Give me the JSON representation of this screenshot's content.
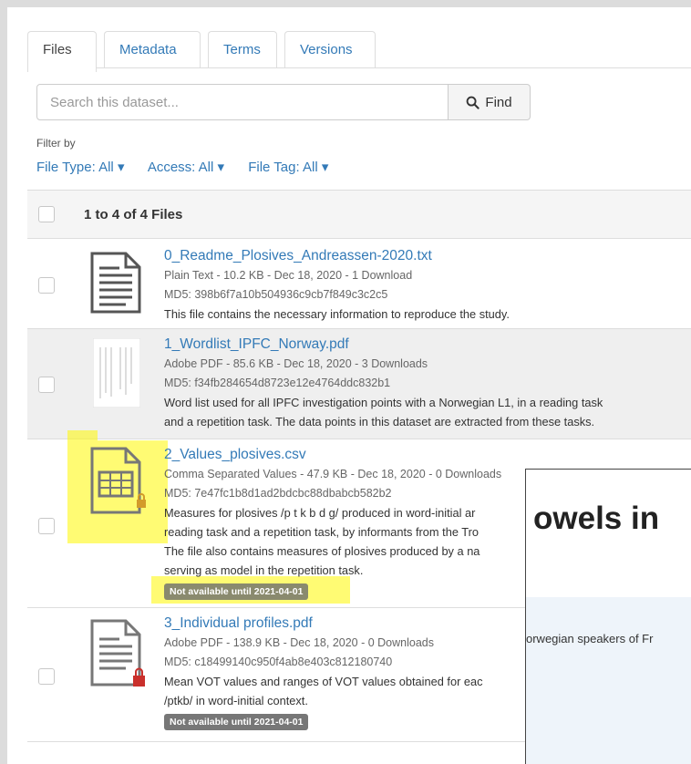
{
  "tabs": [
    {
      "label": "Files"
    },
    {
      "label": "Metadata"
    },
    {
      "label": "Terms"
    },
    {
      "label": "Versions"
    }
  ],
  "search": {
    "placeholder": "Search this dataset...",
    "button": "Find"
  },
  "filter": {
    "label": "Filter by",
    "file_type": "File Type: All",
    "access": "Access: All",
    "file_tag": "File Tag: All"
  },
  "table": {
    "count": "1 to 4 of 4 Files",
    "files": [
      {
        "name": "0_Readme_Plosives_Andreassen-2020.txt",
        "meta": "Plain Text - 10.2 KB - Dec 18, 2020 - 1 Download",
        "md5": "MD5: 398b6f7a10b504936c9cb7f849c3c2c5",
        "desc": "This file contains the necessary information to reproduce the study."
      },
      {
        "name": "1_Wordlist_IPFC_Norway.pdf",
        "meta": "Adobe PDF - 85.6 KB - Dec 18, 2020 - 3 Downloads",
        "md5": "MD5: f34fb284654d8723e12e4764ddc832b1",
        "desc1": "Word list used for all IPFC investigation points with a Norwegian L1, in a reading task",
        "desc2": "and a repetition task. The data points in this dataset are extracted from these tasks."
      },
      {
        "name": "2_Values_plosives.csv",
        "meta": "Comma Separated Values - 47.9 KB - Dec 18, 2020 - 0 Downloads",
        "md5": "MD5: 7e47fc1b8d1ad2bdcbc88dbabcb582b2",
        "desc1": "Measures for plosives /p t k b d g/ produced in word-initial ar",
        "desc2": "reading task and a repetition task, by informants from the Tro",
        "desc3": "The file also contains measures of plosives produced by a na",
        "desc4": "serving as model in the repetition task.",
        "badge": "Not available until 2021-04-01"
      },
      {
        "name": "3_Individual profiles.pdf",
        "meta": "Adobe PDF - 138.9 KB - Dec 18, 2020 - 0 Downloads",
        "md5": "MD5: c18499140c950f4ab8e403c812180740",
        "desc1": "Mean VOT values and ranges of VOT values obtained for eac",
        "desc2": "/ptkb/ in word-initial context.",
        "badge": "Not available until 2021-04-01"
      }
    ]
  },
  "overlay": {
    "heading": "owels in",
    "subtext": "orwegian speakers of Fr"
  }
}
